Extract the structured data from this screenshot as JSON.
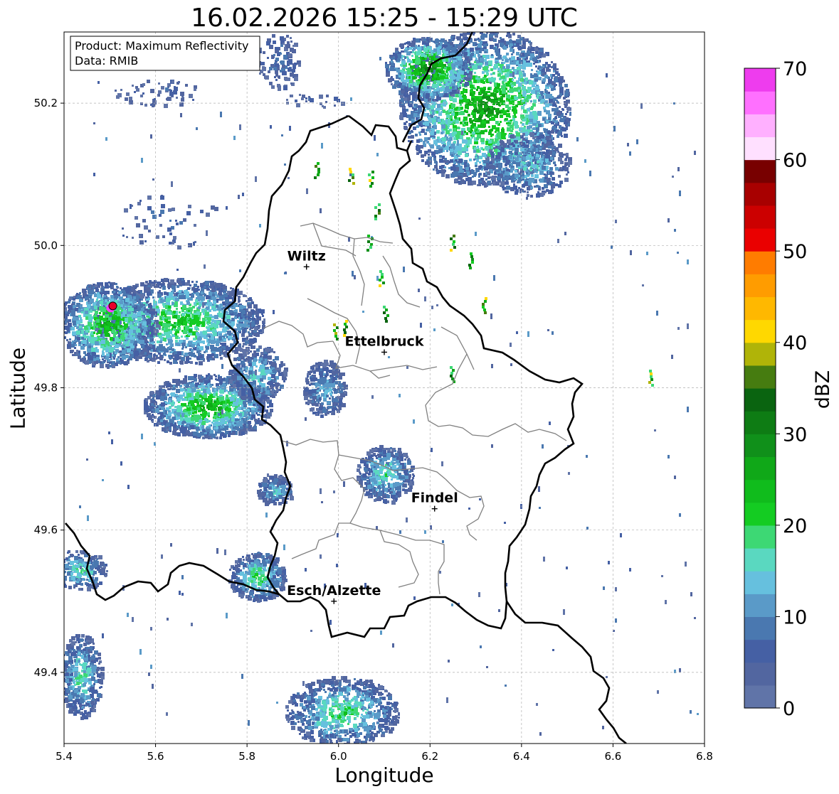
{
  "title": "16.02.2026 15:25 - 15:29 UTC",
  "xlabel": "Longitude",
  "ylabel": "Latitude",
  "info_box": {
    "line1": "Product: Maximum Reflectivity",
    "line2": "Data: RMIB"
  },
  "x_axis": {
    "range": [
      5.4,
      6.8
    ],
    "ticks": [
      "5.4",
      "5.6",
      "5.8",
      "6.0",
      "6.2",
      "6.4",
      "6.6",
      "6.8"
    ]
  },
  "y_axis": {
    "range": [
      49.3,
      50.3
    ],
    "ticks": [
      "49.4",
      "49.6",
      "49.8",
      "50.0",
      "50.2"
    ]
  },
  "grid": true,
  "colorbar": {
    "label": "dBZ",
    "range": [
      0,
      70
    ],
    "ticks": [
      "0",
      "10",
      "20",
      "30",
      "40",
      "50",
      "60",
      "70"
    ],
    "colors": [
      "#6074a8",
      "#5266a0",
      "#4560a4",
      "#4a78b0",
      "#5a9ac8",
      "#66c0de",
      "#5ad8c0",
      "#3dd874",
      "#14cc22",
      "#10bc1c",
      "#10a818",
      "#10901a",
      "#0e7c14",
      "#0a6410",
      "#467c10",
      "#b0b408",
      "#ffd800",
      "#ffb800",
      "#ff9c00",
      "#ff7c00",
      "#ea0000",
      "#cc0000",
      "#a80000",
      "#780000",
      "#ffe0ff",
      "#ffb0ff",
      "#ff70ff",
      "#ee3cee"
    ]
  },
  "cities": [
    {
      "name": "Wiltz",
      "lon": 5.93,
      "lat": 49.97
    },
    {
      "name": "Ettelbruck",
      "lon": 6.1,
      "lat": 49.85
    },
    {
      "name": "Findel",
      "lon": 6.21,
      "lat": 49.63
    },
    {
      "name": "Esch/Alzette",
      "lon": 5.99,
      "lat": 49.5
    }
  ],
  "marker": {
    "lon": 5.505,
    "lat": 49.915,
    "color": "#e8002a"
  }
}
